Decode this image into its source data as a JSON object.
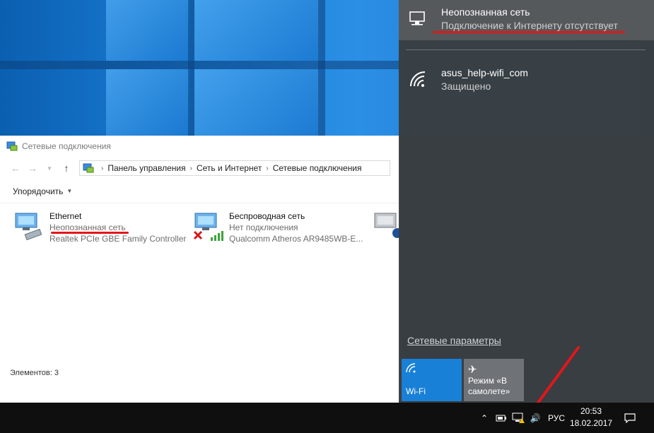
{
  "explorer": {
    "title": "Сетевые подключения",
    "address": [
      "Панель управления",
      "Сеть и Интернет",
      "Сетевые подключения"
    ],
    "organize_label": "Упорядочить",
    "connections": [
      {
        "name": "Ethernet",
        "status": "Неопознанная сеть",
        "device": "Realtek PCIe GBE Family Controller"
      },
      {
        "name": "Беспроводная сеть",
        "status": "Нет подключения",
        "device": "Qualcomm Atheros AR9485WB-E..."
      }
    ],
    "item_count": "Элементов: 3"
  },
  "flyout": {
    "active_network": {
      "name": "Неопознанная сеть",
      "status": "Подключение к Интернету отсутствует"
    },
    "wifi_network": {
      "name": "asus_help-wifi_com",
      "status": "Защищено"
    },
    "settings_link": "Сетевые параметры",
    "tiles": [
      {
        "label": "Wi-Fi",
        "active": true
      },
      {
        "label_line1": "Режим «В",
        "label_line2": "самолете»",
        "active": false
      }
    ]
  },
  "taskbar": {
    "language": "РУС",
    "time": "20:53",
    "date": "18.02.2017"
  },
  "colors": {
    "accent": "#1980d8",
    "annotation_red": "#e0171b",
    "flyout_bg": "#3a3e40"
  }
}
